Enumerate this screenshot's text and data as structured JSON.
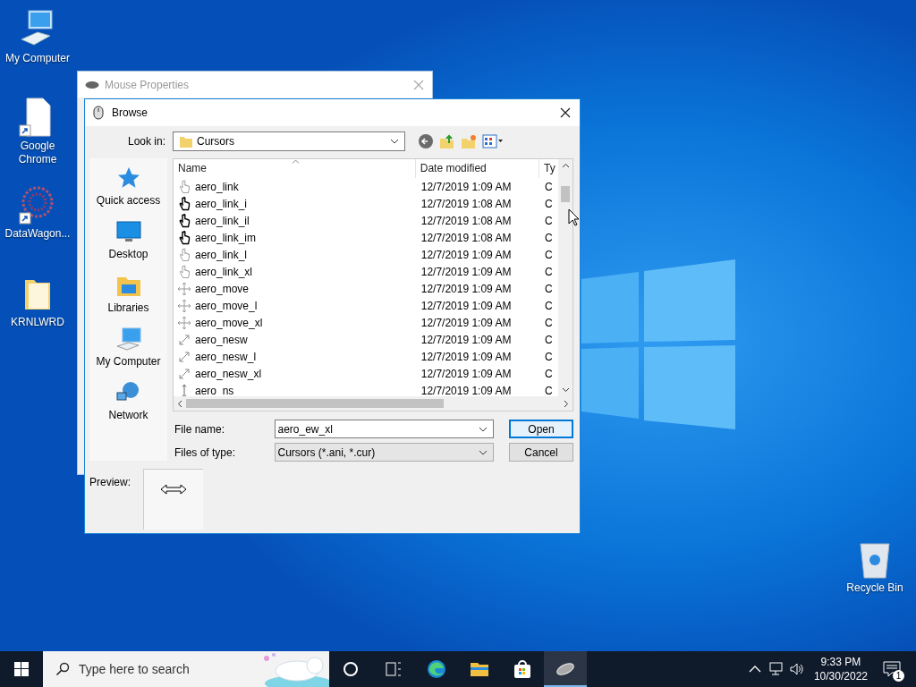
{
  "desktop_icons": [
    {
      "label": "My Computer",
      "kind": "computer",
      "shortcut": false
    },
    {
      "label": "Google Chrome",
      "kind": "file",
      "shortcut": true
    },
    {
      "label": "DataWagon...",
      "kind": "network-art",
      "shortcut": true
    },
    {
      "label": "KRNLWRD",
      "kind": "folder",
      "shortcut": false
    },
    {
      "label": "Recycle Bin",
      "kind": "recycle-bin",
      "shortcut": false
    }
  ],
  "background_window": {
    "title": "Mouse Properties"
  },
  "dialog": {
    "title": "Browse",
    "look_in_label": "Look in:",
    "look_in_value": "Cursors",
    "places": [
      {
        "label": "Quick access",
        "kind": "star"
      },
      {
        "label": "Desktop",
        "kind": "desktop"
      },
      {
        "label": "Libraries",
        "kind": "libraries"
      },
      {
        "label": "My Computer",
        "kind": "computer"
      },
      {
        "label": "Network",
        "kind": "network"
      }
    ],
    "columns": [
      "Name",
      "Date modified",
      "Ty"
    ],
    "files": [
      {
        "name": "aero_link",
        "date": "12/7/2019 1:09 AM",
        "type": "C",
        "kind": "hand-outline"
      },
      {
        "name": "aero_link_i",
        "date": "12/7/2019 1:08 AM",
        "type": "C",
        "kind": "hand-filled"
      },
      {
        "name": "aero_link_il",
        "date": "12/7/2019 1:08 AM",
        "type": "C",
        "kind": "hand-filled"
      },
      {
        "name": "aero_link_im",
        "date": "12/7/2019 1:08 AM",
        "type": "C",
        "kind": "hand-filled"
      },
      {
        "name": "aero_link_l",
        "date": "12/7/2019 1:09 AM",
        "type": "C",
        "kind": "hand-outline"
      },
      {
        "name": "aero_link_xl",
        "date": "12/7/2019 1:09 AM",
        "type": "C",
        "kind": "hand-outline"
      },
      {
        "name": "aero_move",
        "date": "12/7/2019 1:09 AM",
        "type": "C",
        "kind": "move"
      },
      {
        "name": "aero_move_l",
        "date": "12/7/2019 1:09 AM",
        "type": "C",
        "kind": "move"
      },
      {
        "name": "aero_move_xl",
        "date": "12/7/2019 1:09 AM",
        "type": "C",
        "kind": "move"
      },
      {
        "name": "aero_nesw",
        "date": "12/7/2019 1:09 AM",
        "type": "C",
        "kind": "diagonal"
      },
      {
        "name": "aero_nesw_l",
        "date": "12/7/2019 1:09 AM",
        "type": "C",
        "kind": "diagonal"
      },
      {
        "name": "aero_nesw_xl",
        "date": "12/7/2019 1:09 AM",
        "type": "C",
        "kind": "diagonal"
      },
      {
        "name": "aero_ns",
        "date": "12/7/2019 1:09 AM",
        "type": "C",
        "kind": "vertical"
      }
    ],
    "file_name_label": "File name:",
    "file_name": "aero_ew_xl",
    "type_label": "Files of type:",
    "type_value": "Cursors (*.ani, *.cur)",
    "buttons": [
      {
        "label": "Open",
        "default": true
      },
      {
        "label": "Cancel",
        "default": false
      }
    ],
    "preview_label": "Preview:"
  },
  "taskbar": {
    "search_placeholder": "Type here to search",
    "apps": [
      {
        "kind": "cortana",
        "active": false
      },
      {
        "kind": "task-view",
        "active": false
      },
      {
        "kind": "edge",
        "active": false
      },
      {
        "kind": "explorer",
        "active": false
      },
      {
        "kind": "store",
        "active": false
      },
      {
        "kind": "mouse",
        "active": true
      }
    ],
    "time": "9:33 PM",
    "date": "10/30/2022",
    "notification_count": "1"
  }
}
